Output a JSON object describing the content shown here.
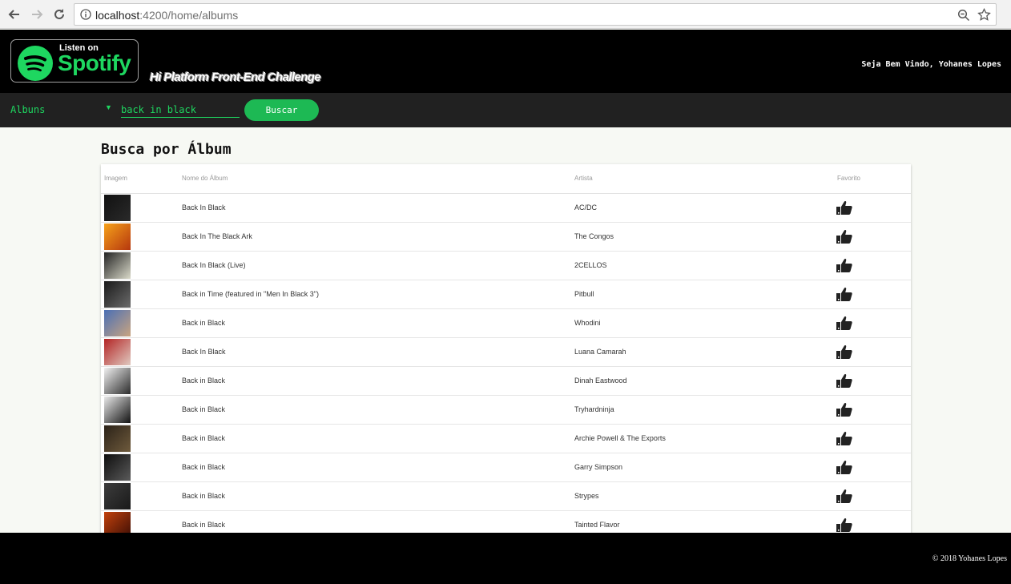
{
  "browser": {
    "url_host": "localhost",
    "url_path": ":4200/home/albums"
  },
  "header": {
    "badge_small": "Listen on",
    "badge_brand": "Spotify",
    "challenge_title": "Hi Platform Front-End Challenge",
    "welcome": "Seja Bem Vindo, Yohanes Lopes"
  },
  "search": {
    "type_label": "Albuns",
    "query": "back in black",
    "button_label": "Buscar"
  },
  "main": {
    "title": "Busca por Álbum",
    "columns": [
      "Imagem",
      "Nome do Álbum",
      "Artista",
      "Favorito"
    ],
    "rows": [
      {
        "album": "Back In Black",
        "artist": "AC/DC",
        "cover": [
          "#111111",
          "#2a2a2a"
        ]
      },
      {
        "album": "Back In The Black Ark",
        "artist": "The Congos",
        "cover": [
          "#f6a11a",
          "#b5370e"
        ]
      },
      {
        "album": "Back In Black (Live)",
        "artist": "2CELLOS",
        "cover": [
          "#222222",
          "#d9d9c9"
        ]
      },
      {
        "album": "Back in Time (featured in \"Men In Black 3\")",
        "artist": "Pitbull",
        "cover": [
          "#1a1a1a",
          "#6b6b6b"
        ]
      },
      {
        "album": "Back in Black",
        "artist": "Whodini",
        "cover": [
          "#4a6fb5",
          "#c9a480"
        ]
      },
      {
        "album": "Back In Black",
        "artist": "Luana Camarah",
        "cover": [
          "#b32424",
          "#e0c9c0"
        ]
      },
      {
        "album": "Back in Black",
        "artist": "Dinah Eastwood",
        "cover": [
          "#f1f1f1",
          "#2b2b2b"
        ]
      },
      {
        "album": "Back in Black",
        "artist": "Tryhardninja",
        "cover": [
          "#e9e9e9",
          "#111111"
        ]
      },
      {
        "album": "Back in Black",
        "artist": "Archie Powell & The Exports",
        "cover": [
          "#2b2218",
          "#6e5a3c"
        ]
      },
      {
        "album": "Back in Black",
        "artist": "Garry Simpson",
        "cover": [
          "#0e0e0e",
          "#5a5a5a"
        ]
      },
      {
        "album": "Back in Black",
        "artist": "Strypes",
        "cover": [
          "#3c3c3c",
          "#1a1a1a"
        ]
      },
      {
        "album": "Back in Black",
        "artist": "Tainted Flavor",
        "cover": [
          "#c2410c",
          "#3b0d05"
        ]
      }
    ]
  },
  "footer": {
    "copyright": "© 2018 Yohanes Lopes"
  },
  "colors": {
    "accent": "#1ed760",
    "button": "#1db954",
    "header_bg": "#000000",
    "search_bg": "#212121"
  }
}
